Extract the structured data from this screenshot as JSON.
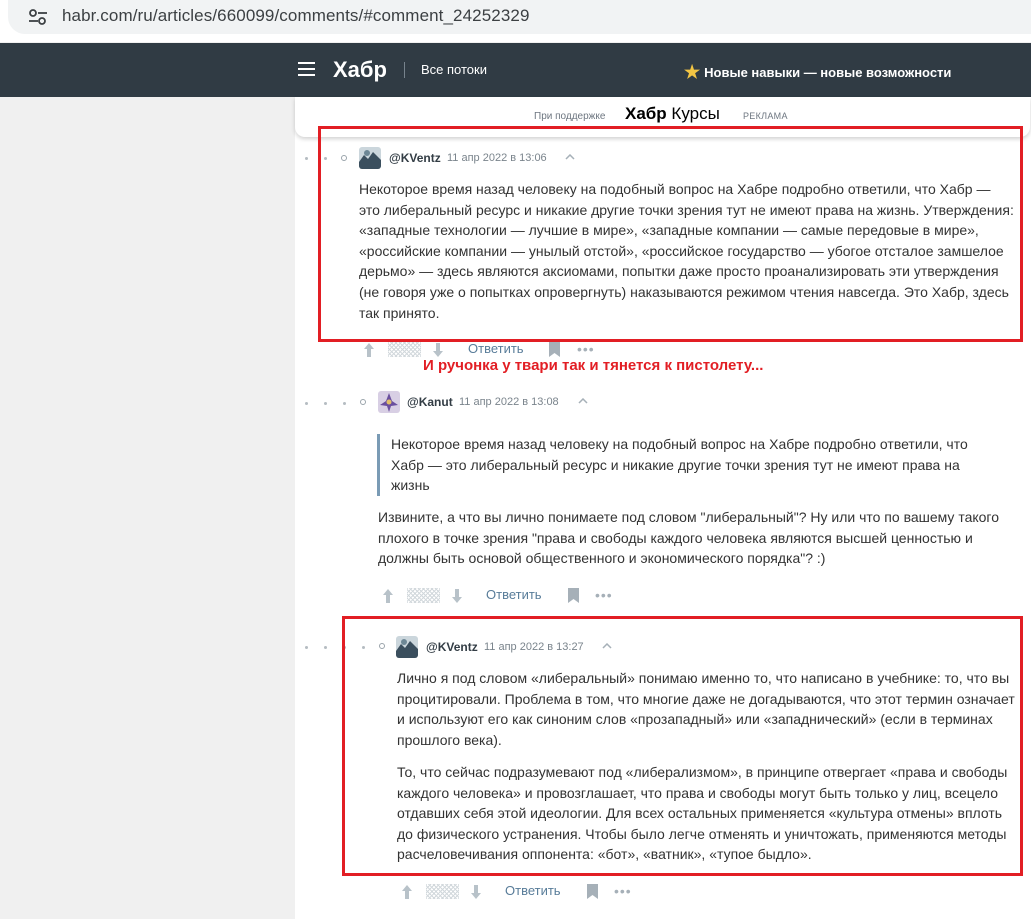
{
  "browser": {
    "url": "habr.com/ru/articles/660099/comments/#comment_24252329",
    "site_icon": "tune-settings-icon"
  },
  "header": {
    "menu_icon": "hamburger-menu-icon",
    "logo": "Хабр",
    "flows": "Все потоки",
    "promo": "Новые навыки — новые возможности",
    "promo_icon": "star-icon",
    "bg_color": "#303b44"
  },
  "sponsor": {
    "prefix": "При поддержке",
    "brand_bold": "Хабр",
    "brand_rest": " Курсы",
    "tag": "РЕКЛАМА"
  },
  "comments": [
    {
      "user": "@KVentz",
      "date": "11 апр 2022 в 13:06",
      "paragraphs": [
        "Некоторое время назад человеку на подобный вопрос на Хабре подробно ответили, что Хабр — это либеральный ресурс и никакие другие точки зрения тут не имеют права на жизнь. Утверждения: «западные технологии — лучшие в мире», «западные компании — самые передовые в мире», «российские компании — унылый отстой», «российское государство — убогое отсталое замшелое дерьмо» — здесь являются аксиомами, попытки даже просто проанализировать эти утверждения (не говоря уже о попытках опровергнуть) наказываются режимом чтения навсегда. Это Хабр, здесь так принято."
      ],
      "reply_label": "Ответить"
    },
    {
      "user": "@Kanut",
      "date": "11 апр 2022 в 13:08",
      "quote": "Некоторое время назад человеку на подобный вопрос на Хабре подробно ответили, что Хабр — это либеральный ресурс и никакие другие точки зрения тут не имеют права на жизнь",
      "paragraphs": [
        "Извините, а что вы лично понимаете под словом \"либеральный\"? Ну или что по вашему такого плохого в точке зрения \"права и свободы каждого человека являются высшей ценностью и должны быть основой общественного и экономического порядка\"? :)"
      ],
      "reply_label": "Ответить"
    },
    {
      "user": "@KVentz",
      "date": "11 апр 2022 в 13:27",
      "paragraphs": [
        "Лично я под словом «либеральный» понимаю именно то, что написано в учебнике: то, что вы процитировали. Проблема в том, что многие даже не догадываются, что этот термин означает и используют его как синоним слов «прозападный» или «западнический» (если в терминах прошлого века).",
        "То, что сейчас подразумевают под «либерализмом», в принципе отвергает «права и свободы каждого человека» и провозглашает, что права и свободы могут быть только у лиц, всецело отдавших себя этой идеологии. Для всех остальных применяется «культура отмены» вплоть до физического устранения. Чтобы было легче отменять и уничтожать, применяются методы расчеловечивания оппонента: «бот», «ватник», «тупое быдло»."
      ],
      "reply_label": "Ответить"
    }
  ],
  "annotation": "И ручонка у твари так и тянется к пистолету...",
  "colors": {
    "highlight_red": "#e21e24",
    "link_blue": "#587c99"
  }
}
